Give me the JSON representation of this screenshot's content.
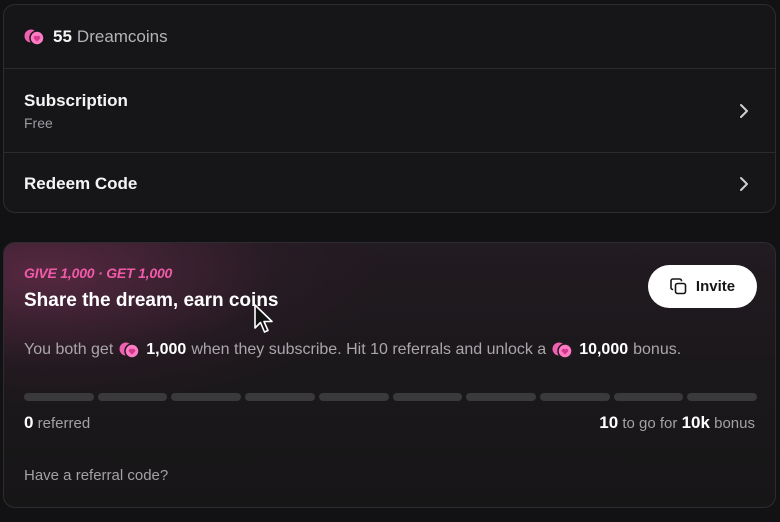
{
  "account": {
    "coins_amount": "55",
    "coins_unit": "Dreamcoins",
    "subscription_label": "Subscription",
    "subscription_value": "Free",
    "redeem_label": "Redeem Code"
  },
  "referral": {
    "tag": "GIVE 1,000 · GET 1,000",
    "title": "Share the dream, earn coins",
    "invite_label": "Invite",
    "desc_part1": "You both get",
    "desc_amount1": "1,000",
    "desc_part2": "when they subscribe. Hit 10 referrals and unlock a",
    "desc_amount2": "10,000",
    "desc_part3": "bonus.",
    "progress_total": 10,
    "progress_done": 0,
    "referred_count": "0",
    "referred_label": "referred",
    "togo_count": "10",
    "togo_label": "to go for",
    "togo_bonus": "10k",
    "togo_suffix": "bonus",
    "have_code": "Have a referral code?"
  },
  "colors": {
    "accent": "#f25aa9",
    "coin": "#f060b0",
    "background": "#121113",
    "card": "#161517"
  },
  "icons": [
    "coin-icon",
    "chevron-right-icon",
    "copy-icon",
    "mouse-cursor-icon"
  ]
}
